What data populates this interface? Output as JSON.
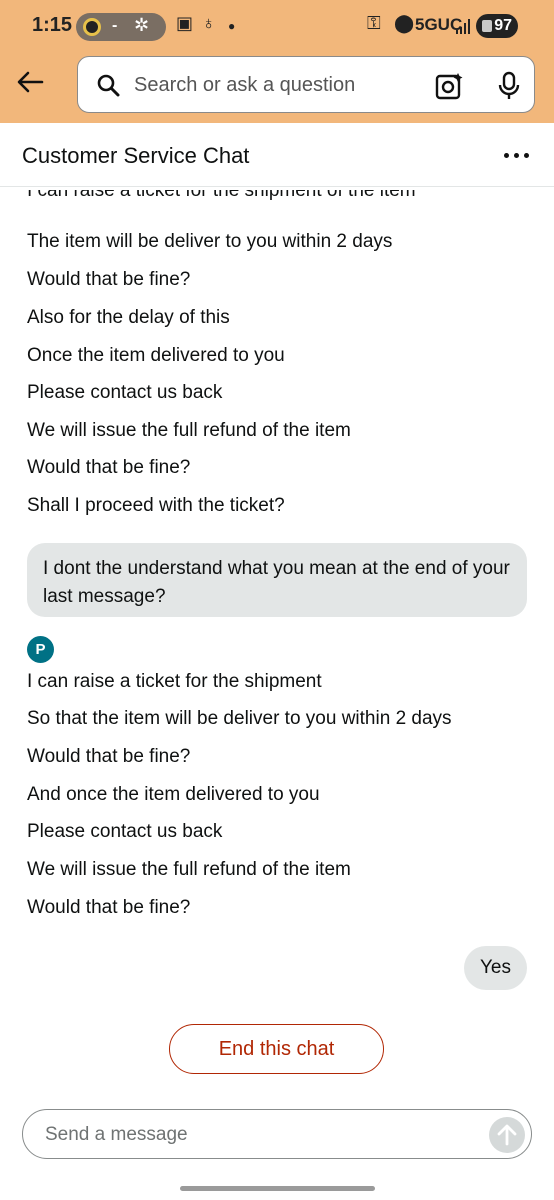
{
  "status_bar": {
    "time": "1:15",
    "network": "5GUC",
    "battery": "97"
  },
  "search": {
    "placeholder": "Search or ask a question"
  },
  "chat": {
    "title": "Customer Service Chat",
    "clipped_line": "I can raise a ticket for the shipment of the item",
    "agent_block_1": [
      "The item will be deliver to you within 2 days",
      "Would that be fine?",
      "Also for the delay of this",
      "Once the item delivered to you",
      "Please contact us back",
      "We will issue the full refund of the item",
      "Would that be fine?",
      "Shall I proceed with the ticket?"
    ],
    "user_message": "I dont the understand what you mean at the end of your last message?",
    "agent_avatar_letter": "P",
    "agent_block_2": [
      "I can raise a ticket for the shipment",
      "So that the item will be deliver to you within 2 days",
      "Would that be fine?",
      "And once the item delivered to you",
      "Please contact us back",
      "We will issue the full refund of the item",
      "Would that be fine?"
    ],
    "user_reply": "Yes",
    "end_chat_label": "End this chat"
  },
  "compose": {
    "placeholder": "Send a message"
  },
  "icons": {
    "back": "arrow-left-icon",
    "search": "search-icon",
    "camera": "camera-lens-icon",
    "mic": "microphone-icon",
    "more": "more-dots-icon",
    "send": "arrow-up-icon"
  },
  "colors": {
    "header_bg": "#f2b77b",
    "agent_avatar": "#007185",
    "end_chat": "#b12704",
    "bubble_bg": "#e3e6e6"
  }
}
